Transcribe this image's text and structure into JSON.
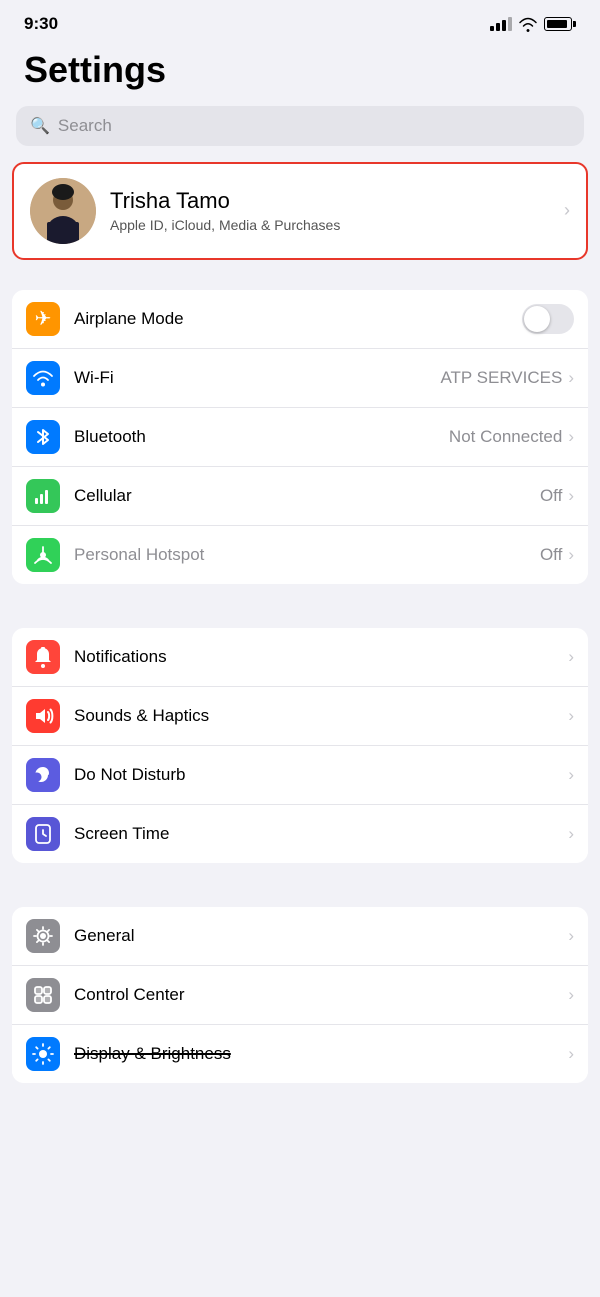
{
  "statusBar": {
    "time": "9:30"
  },
  "header": {
    "title": "Settings"
  },
  "search": {
    "placeholder": "Search"
  },
  "profile": {
    "name": "Trisha Tamo",
    "subtitle": "Apple ID, iCloud, Media & Purchases"
  },
  "sections": [
    {
      "id": "connectivity",
      "rows": [
        {
          "id": "airplane",
          "label": "Airplane Mode",
          "value": "",
          "hasToggle": true,
          "iconColor": "orange",
          "iconGlyph": "✈"
        },
        {
          "id": "wifi",
          "label": "Wi-Fi",
          "value": "ATP SERVICES",
          "hasToggle": false,
          "iconColor": "blue",
          "iconGlyph": "wifi"
        },
        {
          "id": "bluetooth",
          "label": "Bluetooth",
          "value": "Not Connected",
          "hasToggle": false,
          "iconColor": "blue-light",
          "iconGlyph": "bluetooth"
        },
        {
          "id": "cellular",
          "label": "Cellular",
          "value": "Off",
          "hasToggle": false,
          "iconColor": "green",
          "iconGlyph": "cellular"
        },
        {
          "id": "hotspot",
          "label": "Personal Hotspot",
          "value": "Off",
          "hasToggle": false,
          "iconColor": "green2",
          "iconGlyph": "hotspot",
          "disabled": true
        }
      ]
    },
    {
      "id": "notifications",
      "rows": [
        {
          "id": "notifications",
          "label": "Notifications",
          "value": "",
          "hasToggle": false,
          "iconColor": "red2",
          "iconGlyph": "notifications"
        },
        {
          "id": "sounds",
          "label": "Sounds & Haptics",
          "value": "",
          "hasToggle": false,
          "iconColor": "red",
          "iconGlyph": "sounds"
        },
        {
          "id": "donotdisturb",
          "label": "Do Not Disturb",
          "value": "",
          "hasToggle": false,
          "iconColor": "indigo",
          "iconGlyph": "moon"
        },
        {
          "id": "screentime",
          "label": "Screen Time",
          "value": "",
          "hasToggle": false,
          "iconColor": "purple2",
          "iconGlyph": "screentime"
        }
      ]
    },
    {
      "id": "system",
      "rows": [
        {
          "id": "general",
          "label": "General",
          "value": "",
          "hasToggle": false,
          "iconColor": "gray2",
          "iconGlyph": "general"
        },
        {
          "id": "controlcenter",
          "label": "Control Center",
          "value": "",
          "hasToggle": false,
          "iconColor": "gray",
          "iconGlyph": "controlcenter"
        },
        {
          "id": "display",
          "label": "Display & Brightness",
          "value": "",
          "hasToggle": false,
          "iconColor": "blue",
          "iconGlyph": "display",
          "strikethrough": true
        }
      ]
    }
  ]
}
